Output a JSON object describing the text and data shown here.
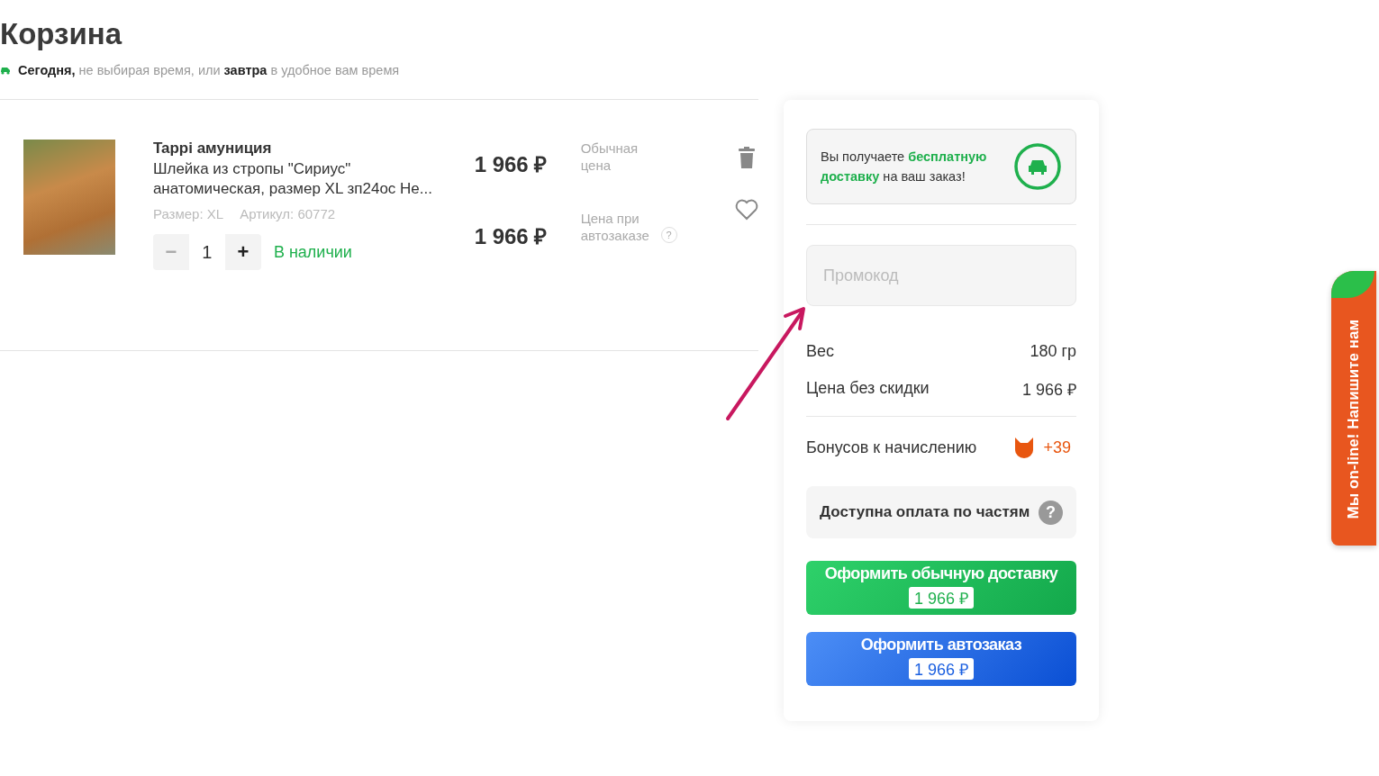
{
  "page": {
    "title": "Корзина",
    "delivery_note": "**Сегодня,** не выбирая время, или **завтра** в удобное вам время"
  },
  "cart_items": [
    {
      "brand": "Tappi амуниция",
      "name": "Шлейка из стропы \"Сириус\" анатомическая, размер XL зп24ос Не...",
      "size": "Размер: XL",
      "sku": "Артикул: 60772",
      "quantity": "1",
      "minus": "−",
      "plus": "+",
      "availability": "В наличии",
      "regular_price": "1 966 ₽",
      "regular_price_label": "Обычная цена",
      "autoorder_price": "1 966 ₽",
      "autoorder_price_label": "Цена при автозаказе",
      "help": "?"
    }
  ],
  "summary": {
    "free_delivery": "Вы получаете **бесплатную доставку** на ваш заказ!",
    "promo_placeholder": "Промокод",
    "rows": [
      {
        "label": "Вес",
        "value": "180 гр"
      },
      {
        "label": "Цена без скидки",
        "value": "1 966 ₽"
      }
    ],
    "bonus": {
      "label": "Бонусов к начислению",
      "value": "+39"
    },
    "installments": {
      "label": "Доступна оплата по частям",
      "help": "?"
    },
    "buttons": [
      {
        "kind": "regular",
        "label": "Оформить обычную доставку",
        "price": "1 966 ₽"
      },
      {
        "kind": "autoorder",
        "label": "Оформить автозаказ",
        "price": "1 966 ₽"
      }
    ]
  },
  "chat_tab": {
    "label": "Мы on-line! Напишите нам"
  }
}
